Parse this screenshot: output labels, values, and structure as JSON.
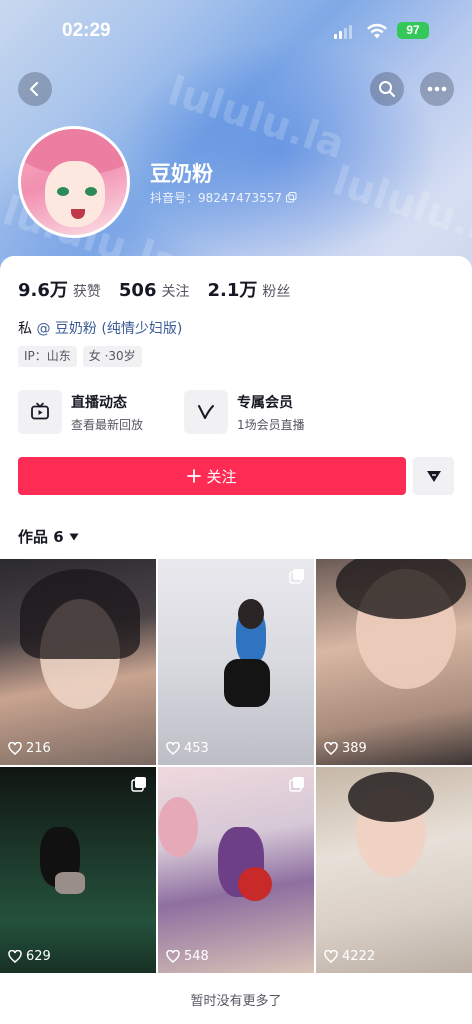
{
  "status_bar": {
    "time": "02:29",
    "battery": "97"
  },
  "profile": {
    "nickname": "豆奶粉",
    "douyin_id": "抖音号：98247473557",
    "stats": [
      {
        "num": "9.6万",
        "label": "获赞"
      },
      {
        "num": "506",
        "label": "关注"
      },
      {
        "num": "2.1万",
        "label": "粉丝"
      }
    ],
    "bio_prefix": "私",
    "bio_mention": "@ 豆奶粉 (纯情少妇版)",
    "tags": [
      "IP：山东",
      "女 ·30岁"
    ]
  },
  "features": {
    "live": {
      "title": "直播动态",
      "subtitle": "查看最新回放"
    },
    "member": {
      "title": "专属会员",
      "subtitle": "1场会员直播"
    }
  },
  "follow_button": {
    "label": "关注"
  },
  "works": {
    "title": "作品 6",
    "items": [
      {
        "likes": "216",
        "multi": false
      },
      {
        "likes": "453",
        "multi": true
      },
      {
        "likes": "389",
        "multi": false
      },
      {
        "likes": "629",
        "multi": true
      },
      {
        "likes": "548",
        "multi": true
      },
      {
        "likes": "4222",
        "multi": false
      }
    ]
  },
  "footer": {
    "no_more": "暂时没有更多了"
  },
  "watermark": "lululu.la",
  "colors": {
    "accent": "#fe2c55",
    "mention": "#3a5b96",
    "battery": "#34c759"
  }
}
